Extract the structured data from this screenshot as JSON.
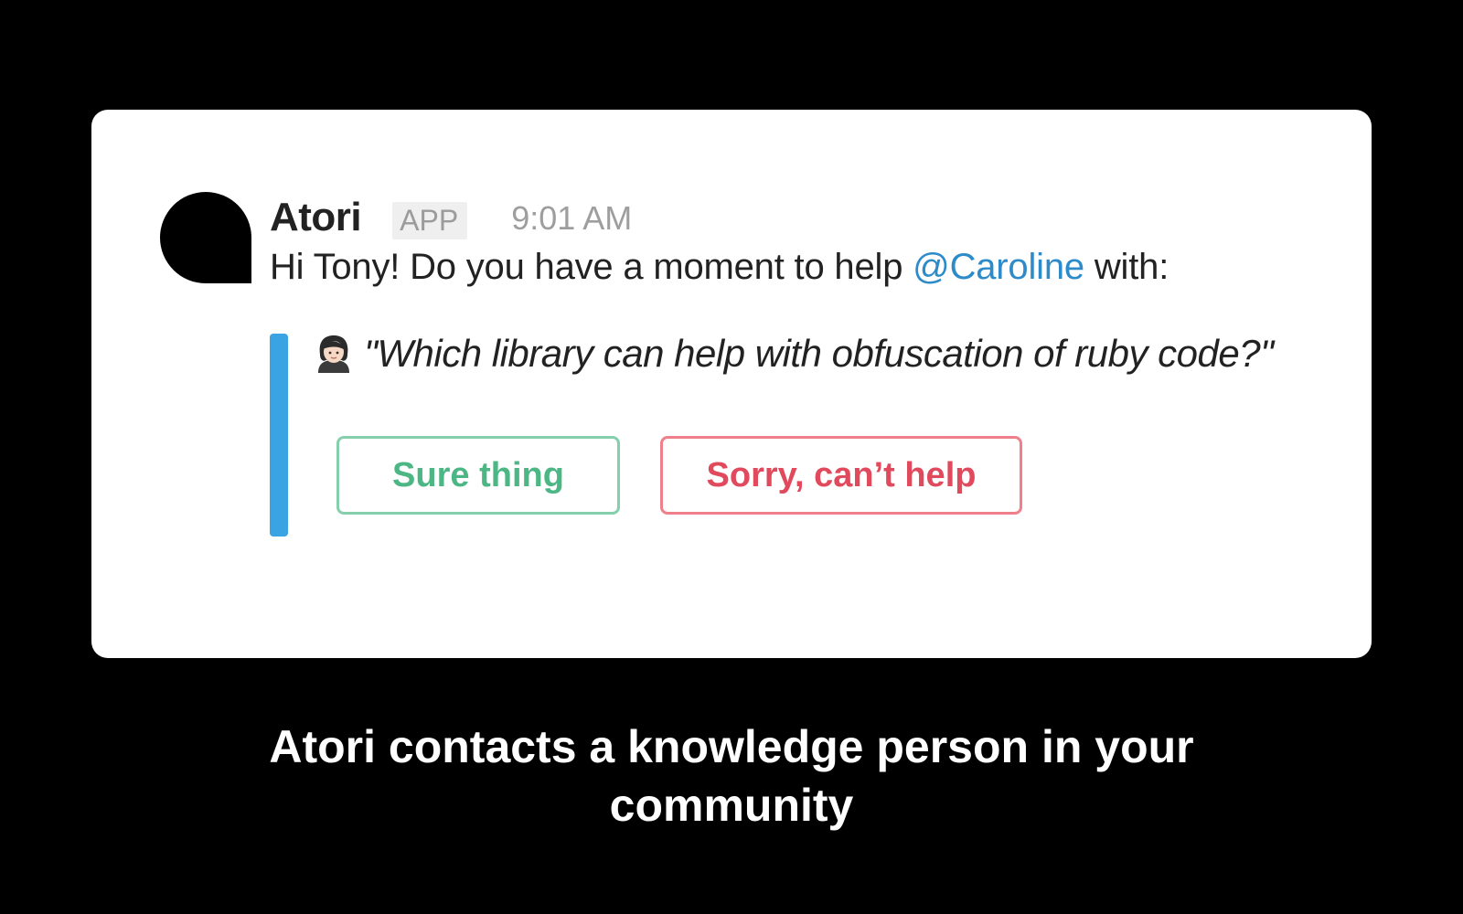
{
  "message": {
    "sender": "Atori",
    "badge": "APP",
    "time": "9:01 AM",
    "text_before": "Hi Tony! Do you have a moment to help ",
    "mention": "@Caroline",
    "text_after": " with:"
  },
  "attachment": {
    "accent_color": "#3aa3e3",
    "icon": "person-icon",
    "quote": "\"Which library can help with obfuscation of ruby code?\"",
    "buttons": {
      "accept_label": "Sure thing",
      "decline_label": "Sorry, can’t help"
    }
  },
  "colors": {
    "accept": "#4cb784",
    "decline": "#e04a5c",
    "mention": "#2d8bc9"
  },
  "caption": {
    "line1": "Atori contacts a knowledge person in your",
    "line2": "community"
  }
}
